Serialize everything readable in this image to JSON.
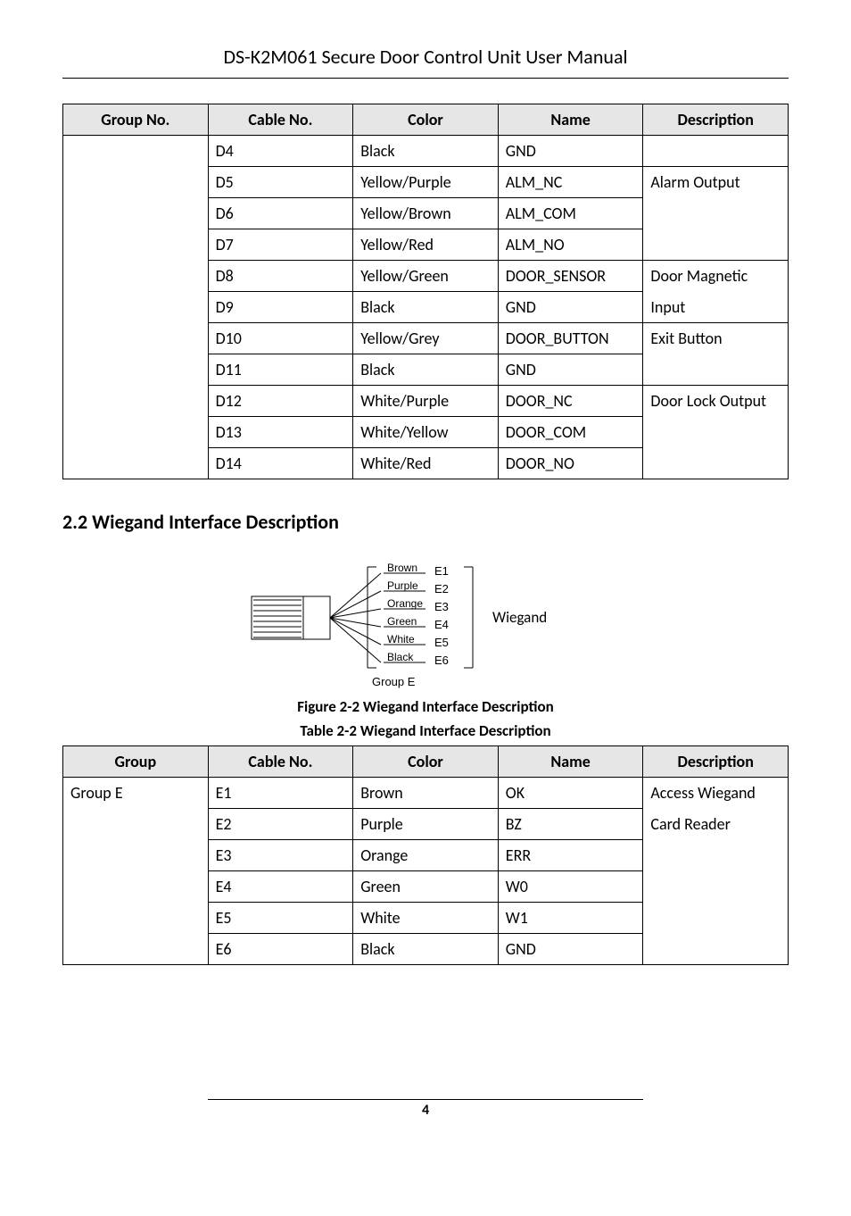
{
  "header": {
    "title": "DS-K2M061 Secure Door Control Unit User Manual"
  },
  "table1": {
    "headers": [
      "Group No.",
      "Cable No.",
      "Color",
      "Name",
      "Description"
    ],
    "rows": [
      {
        "cable": "D4",
        "color": "Black",
        "name": "GND",
        "desc": ""
      },
      {
        "cable": "D5",
        "color": "Yellow/Purple",
        "name": "ALM_NC",
        "desc": "Alarm Output"
      },
      {
        "cable": "D6",
        "color": "Yellow/Brown",
        "name": "ALM_COM",
        "desc": ""
      },
      {
        "cable": "D7",
        "color": "Yellow/Red",
        "name": "ALM_NO",
        "desc": ""
      },
      {
        "cable": "D8",
        "color": "Yellow/Green",
        "name": "DOOR_SENSOR",
        "desc": "Door Magnetic"
      },
      {
        "cable": "D9",
        "color": "Black",
        "name": "GND",
        "desc": "Input"
      },
      {
        "cable": "D10",
        "color": "Yellow/Grey",
        "name": "DOOR_BUTTON",
        "desc": "Exit Button"
      },
      {
        "cable": "D11",
        "color": "Black",
        "name": "GND",
        "desc": ""
      },
      {
        "cable": "D12",
        "color": "White/Purple",
        "name": "DOOR_NC",
        "desc": "Door Lock Output"
      },
      {
        "cable": "D13",
        "color": "White/Yellow",
        "name": "DOOR_COM",
        "desc": ""
      },
      {
        "cable": "D14",
        "color": "White/Red",
        "name": "DOOR_NO",
        "desc": ""
      }
    ]
  },
  "section": {
    "heading": "2.2 Wiegand Interface Description"
  },
  "figure": {
    "caption": "Figure 2-2 Wiegand Interface Description",
    "wires": [
      {
        "color": "Brown",
        "e": "E1"
      },
      {
        "color": "Purple",
        "e": "E2"
      },
      {
        "color": "Orange",
        "e": "E3"
      },
      {
        "color": "Green",
        "e": "E4"
      },
      {
        "color": "White",
        "e": "E5"
      },
      {
        "color": "Black",
        "e": "E6"
      }
    ],
    "group_label": "Group E",
    "side_label": "Wiegand"
  },
  "table2": {
    "caption": "Table 2-2 Wiegand Interface Description",
    "headers": [
      "Group",
      "Cable No.",
      "Color",
      "Name",
      "Description"
    ],
    "group": "Group E",
    "desc1": "Access Wiegand",
    "desc2": "Card Reader",
    "rows": [
      {
        "cable": "E1",
        "color": "Brown",
        "name": "OK"
      },
      {
        "cable": "E2",
        "color": "Purple",
        "name": "BZ"
      },
      {
        "cable": "E3",
        "color": "Orange",
        "name": "ERR"
      },
      {
        "cable": "E4",
        "color": "Green",
        "name": "W0"
      },
      {
        "cable": "E5",
        "color": "White",
        "name": "W1"
      },
      {
        "cable": "E6",
        "color": "Black",
        "name": "GND"
      }
    ]
  },
  "footer": {
    "page": "4"
  }
}
